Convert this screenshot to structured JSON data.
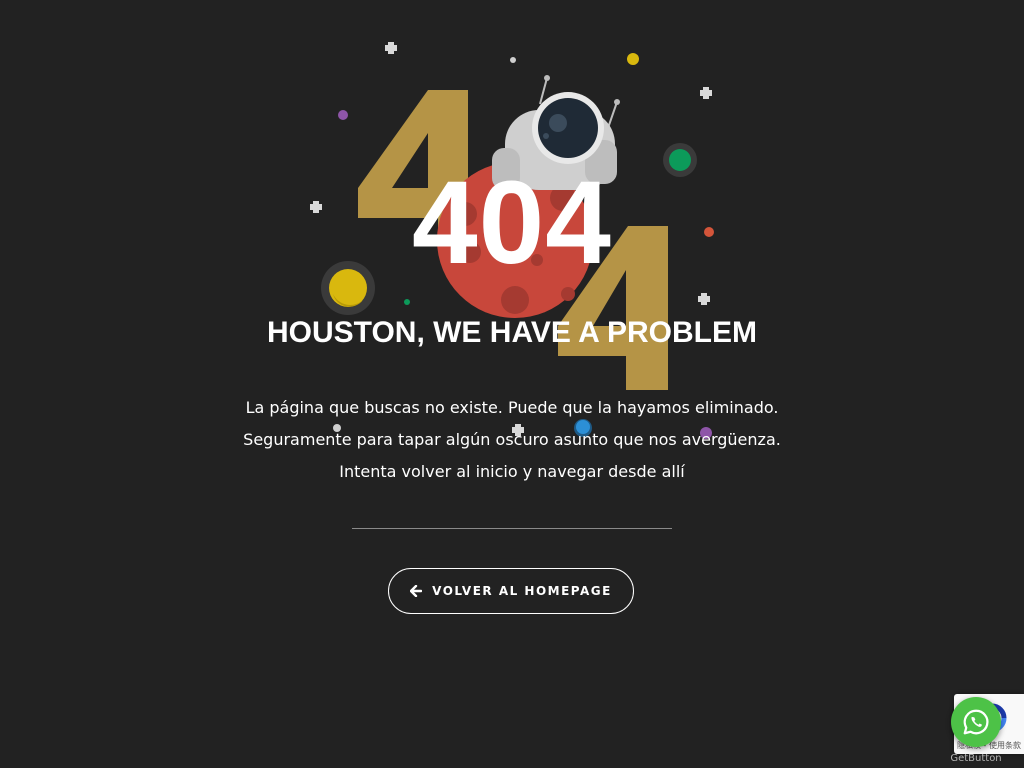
{
  "error": {
    "code": "404",
    "headline": "HOUSTON, WE HAVE A PROBLEM",
    "message_lines": [
      "La página que buscas no existe. Puede que la hayamos eliminado.",
      "Seguramente para tapar algún oscuro asunto que nos avergüenza.",
      "Intenta volver al inicio y navegar desde allí"
    ]
  },
  "home_button": {
    "label": "VOLVER AL HOMEPAGE",
    "icon": "arrow-left-icon"
  },
  "illustration": {
    "background_digits": [
      "4",
      "4"
    ],
    "icons": [
      "astronaut-icon",
      "planet-icon",
      "star-icon"
    ],
    "colors": {
      "background": "#222222",
      "digit_gold": "#b59446",
      "planet_red": "#c8473b",
      "planet_yellow": "#d9b80e",
      "planet_green": "#0c9a5a",
      "dot_purple": "#8e55a8",
      "dot_blue": "#2c8fd6",
      "dot_orange": "#d4553a"
    }
  },
  "widgets": {
    "recaptcha_terms": "隐私权 - 使用条款",
    "whatsapp_icon": "whatsapp-icon",
    "getbutton_label": "GetButton"
  }
}
